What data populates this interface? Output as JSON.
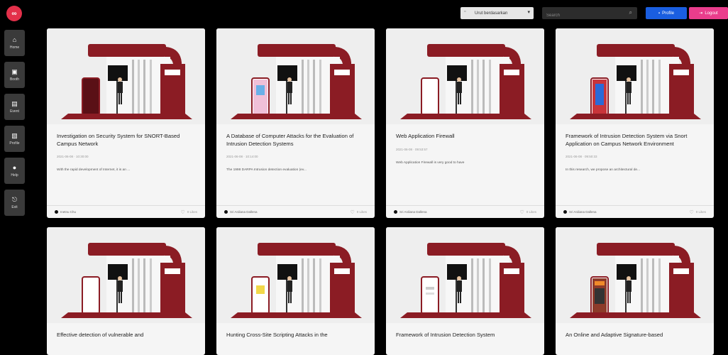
{
  "sidebar": {
    "logo": "∞",
    "items": [
      {
        "label": "Home",
        "icon": "home-icon",
        "glyph": "⌂"
      },
      {
        "label": "Booth",
        "icon": "booth-icon",
        "glyph": "▣"
      },
      {
        "label": "Event",
        "icon": "event-icon",
        "glyph": "▤"
      },
      {
        "label": "Profile",
        "icon": "profile-icon",
        "glyph": "▧"
      },
      {
        "label": "Help",
        "icon": "help-icon",
        "glyph": "●"
      },
      {
        "label": "Exit",
        "icon": "exit-icon",
        "glyph": "⎋"
      }
    ]
  },
  "topbar": {
    "select_value": "Urut berdasarkan",
    "search_placeholder": "Search",
    "profile_label": "Profile",
    "logout_label": "Logout"
  },
  "colors": {
    "brand": "#e3304a",
    "profile": "#1a5ee0",
    "logout": "#ea3d8c",
    "booth_red": "#8b1c24"
  },
  "cards": [
    {
      "title": "Investigation on Security System for SNORT-Based Campus Network",
      "date": "2021-06-08 · 10:30:00",
      "excerpt": "With the rapid development of Internet, it is an ...",
      "author": "Inetnu Chu",
      "likes": "0 Likes",
      "panel": "dark"
    },
    {
      "title": "A Database of Computer Attacks for the Evaluation of Intrusion Detection Systems",
      "date": "2021-06-08 · 10:14:00",
      "excerpt": "The 1998 DARPA Intrusion detection evaluation (ev...",
      "author": "Sri Ardiana Dallena",
      "likes": "0 Likes",
      "panel": "color"
    },
    {
      "title": "Web Application Firewall",
      "date": "2021-06-08 · 09:53:57",
      "excerpt": "Web Application Firewall is very good to have",
      "author": "Sri Ardiana Dallena",
      "likes": "0 Likes",
      "panel": "light"
    },
    {
      "title": "Framework of Intrusion Detection System via Snort Application on Campus Network Environment",
      "date": "2021-06-08 · 09:50:33",
      "excerpt": "In this research, we propose an architectural de...",
      "author": "Sri Ardiana Dallena",
      "likes": "0 Likes",
      "panel": "phone"
    },
    {
      "title": "Effective detection of vulnerable and",
      "date": "",
      "excerpt": "",
      "author": "",
      "likes": "",
      "panel": "light"
    },
    {
      "title": "Hunting Cross-Site Scripting Attacks in the",
      "date": "",
      "excerpt": "",
      "author": "",
      "likes": "",
      "panel": "color2"
    },
    {
      "title": "Framework of Intrusion Detection System",
      "date": "",
      "excerpt": "",
      "author": "",
      "likes": "",
      "panel": "doc"
    },
    {
      "title": "An Online and Adaptive Signature-based",
      "date": "",
      "excerpt": "",
      "author": "",
      "likes": "",
      "panel": "poster"
    }
  ]
}
